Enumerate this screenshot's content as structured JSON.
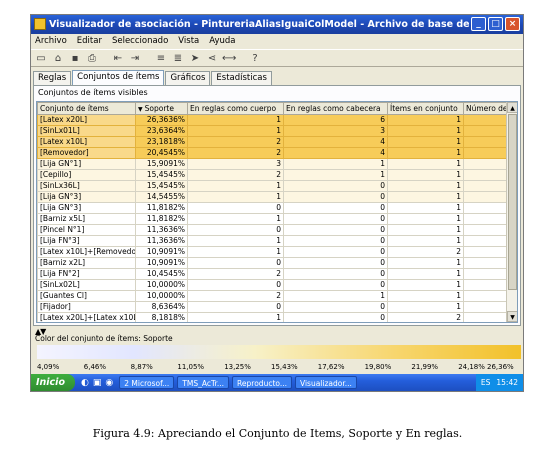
{
  "window": {
    "title": "Visualizador de asociación - PintureriaAliasIguaiColModel - Archivo de base de datos PintureriaAliasIguaiColMod...",
    "buttons": [
      "_",
      "□",
      "×"
    ]
  },
  "menu": [
    "Archivo",
    "Editar",
    "Seleccionado",
    "Vista",
    "Ayuda"
  ],
  "toolbar_icons": [
    "new-icon",
    "open-icon",
    "save-icon",
    "print-icon",
    "arrow-left-icon",
    "arrow-right-icon",
    "filter-icon",
    "filter-icon",
    "arrow-icon",
    "share-icon",
    "link-icon",
    "help-icon"
  ],
  "tabs": [
    {
      "label": "Reglas",
      "active": false
    },
    {
      "label": "Conjuntos de ítems",
      "active": true
    },
    {
      "label": "Gráficos",
      "active": false
    },
    {
      "label": "Estadísticas",
      "active": false
    }
  ],
  "pane_caption": "Conjuntos de ítems visibles",
  "table": {
    "headers": [
      "Conjunto de ítems",
      "Soporte",
      "En reglas como cuerpo",
      "En reglas como cabecera",
      "Ítems en conjunto",
      "Número de"
    ],
    "rows": [
      {
        "c": [
          "[Latex x20L]",
          "26,3636%",
          "1",
          "6",
          "1"
        ],
        "style": "hl"
      },
      {
        "c": [
          "[SinLx01L]",
          "23,6364%",
          "1",
          "3",
          "1"
        ],
        "style": "hl"
      },
      {
        "c": [
          "[Latex x10L]",
          "23,1818%",
          "2",
          "4",
          "1"
        ],
        "style": "hl"
      },
      {
        "c": [
          "[Removedor]",
          "20,4545%",
          "2",
          "4",
          "1"
        ],
        "style": "hl"
      },
      {
        "c": [
          "[Lija GN°1]",
          "15,9091%",
          "3",
          "1",
          "1"
        ],
        "style": "pale"
      },
      {
        "c": [
          "[Cepillo]",
          "15,4545%",
          "2",
          "1",
          "1"
        ],
        "style": "pale"
      },
      {
        "c": [
          "[SinLx36L]",
          "15,4545%",
          "1",
          "0",
          "1"
        ],
        "style": "pale"
      },
      {
        "c": [
          "[Lija GN°3]",
          "14,5455%",
          "1",
          "0",
          "1"
        ],
        "style": "pale"
      },
      {
        "c": [
          "[Lija GN°3]",
          "11,8182%",
          "0",
          "0",
          "1"
        ],
        "style": ""
      },
      {
        "c": [
          "[Barniz x5L]",
          "11,8182%",
          "1",
          "0",
          "1"
        ],
        "style": ""
      },
      {
        "c": [
          "[Pincel N°1]",
          "11,3636%",
          "0",
          "0",
          "1"
        ],
        "style": ""
      },
      {
        "c": [
          "[Lija FN°3]",
          "11,3636%",
          "1",
          "0",
          "1"
        ],
        "style": ""
      },
      {
        "c": [
          "[Latex x10L]+[Removedor]",
          "10,9091%",
          "1",
          "0",
          "2"
        ],
        "style": ""
      },
      {
        "c": [
          "[Barniz x2L]",
          "10,9091%",
          "0",
          "0",
          "1"
        ],
        "style": ""
      },
      {
        "c": [
          "[Lija FN°2]",
          "10,4545%",
          "2",
          "0",
          "1"
        ],
        "style": ""
      },
      {
        "c": [
          "[SinLx02L]",
          "10,0000%",
          "0",
          "0",
          "1"
        ],
        "style": ""
      },
      {
        "c": [
          "[Guantes Cl]",
          "10,0000%",
          "2",
          "1",
          "1"
        ],
        "style": ""
      },
      {
        "c": [
          "[Fijador]",
          "8,6364%",
          "0",
          "0",
          "1"
        ],
        "style": ""
      },
      {
        "c": [
          "[Latex x20L]+[Latex x10L]",
          "8,1818%",
          "1",
          "0",
          "2"
        ],
        "style": ""
      }
    ]
  },
  "legend": {
    "caption": "Color del conjunto de ítems: Soporte",
    "ticks": [
      "4,09%",
      "6,46%",
      "8,87%",
      "11,05%",
      "13,25%",
      "15,43%",
      "17,62%",
      "19,80%",
      "21,99%",
      "24,18%",
      "26,36%"
    ]
  },
  "taskbar": {
    "start": "Inicio",
    "tasks": [
      "2 Microsof...",
      "TMS_AcTr...",
      "Reproducto...",
      "Visualizador..."
    ],
    "tray": [
      "ES",
      "15:42"
    ]
  },
  "figure_caption": "Figura 4.9: Apreciando el Conjunto de Items, Soporte y En reglas."
}
